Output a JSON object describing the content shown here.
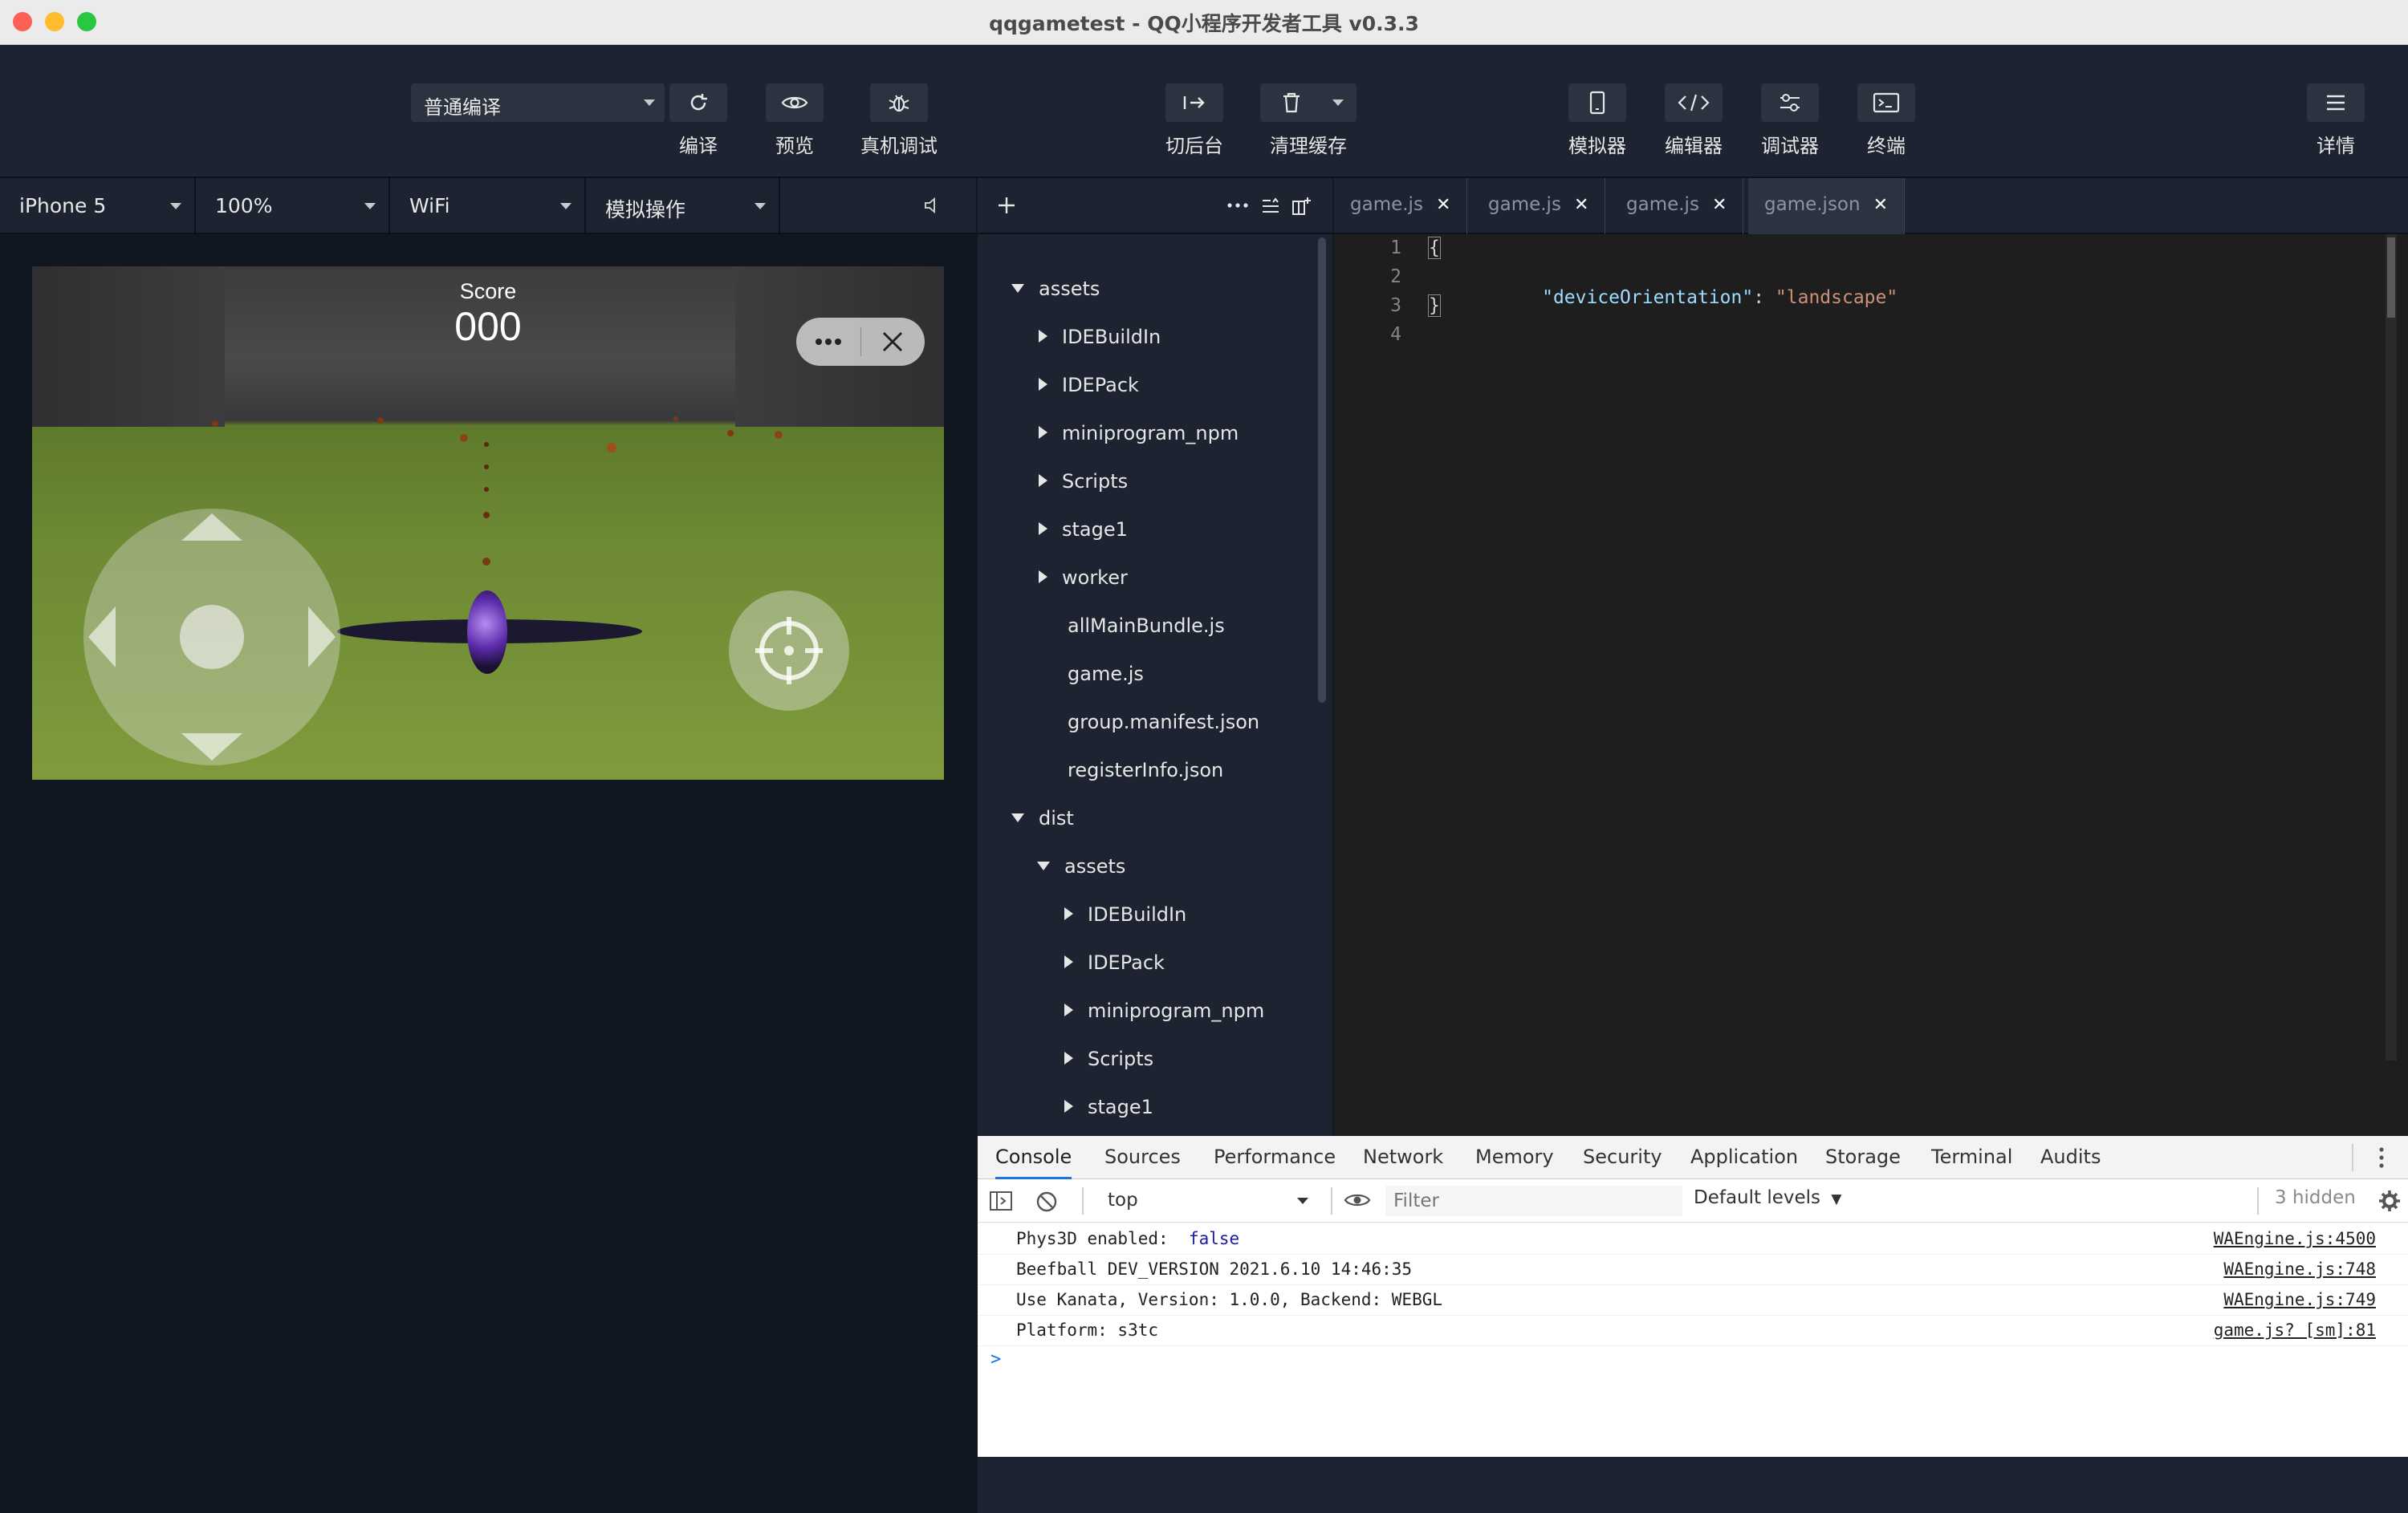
{
  "window": {
    "title": "qqgametest - QQ小程序开发者工具 v0.3.3"
  },
  "toolbar": {
    "compile_mode": "普通编译",
    "compile": "编译",
    "preview": "预览",
    "remote_debug": "真机调试",
    "background": "切后台",
    "clear_cache": "清理缓存",
    "simulator": "模拟器",
    "editor": "编辑器",
    "debugger": "调试器",
    "terminal": "终端",
    "details": "详情"
  },
  "devicebar": {
    "device": "iPhone 5",
    "zoom": "100%",
    "network": "WiFi",
    "operation": "模拟操作"
  },
  "game": {
    "score_label": "Score",
    "score_value": "000"
  },
  "filetree": {
    "items": [
      {
        "label": "assets",
        "type": "folder-open"
      },
      {
        "label": "IDEBuildIn",
        "type": "folder"
      },
      {
        "label": "IDEPack",
        "type": "folder"
      },
      {
        "label": "miniprogram_npm",
        "type": "folder"
      },
      {
        "label": "Scripts",
        "type": "folder"
      },
      {
        "label": "stage1",
        "type": "folder"
      },
      {
        "label": "worker",
        "type": "folder"
      },
      {
        "label": "allMainBundle.js",
        "type": "file"
      },
      {
        "label": "game.js",
        "type": "file"
      },
      {
        "label": "group.manifest.json",
        "type": "file"
      },
      {
        "label": "registerInfo.json",
        "type": "file"
      },
      {
        "label": "dist",
        "type": "folder-open"
      },
      {
        "label": "assets",
        "type": "folder-open"
      },
      {
        "label": "IDEBuildIn",
        "type": "folder"
      },
      {
        "label": "IDEPack",
        "type": "folder"
      },
      {
        "label": "miniprogram_npm",
        "type": "folder"
      },
      {
        "label": "Scripts",
        "type": "folder"
      },
      {
        "label": "stage1",
        "type": "folder"
      }
    ]
  },
  "editor": {
    "tabs": [
      "game.js",
      "game.js",
      "game.js",
      "game.json"
    ],
    "active_tab": "game.json",
    "line_numbers": [
      "1",
      "2",
      "3",
      "4"
    ],
    "line1": "{",
    "line2_key": "\"deviceOrientation\"",
    "line2_colon": ": ",
    "line2_value": "\"landscape\"",
    "line3": "}",
    "colors": {
      "key": "#9cdcfe",
      "string": "#ce9178",
      "brace": "#d4d4d4"
    }
  },
  "devtools": {
    "tabs": [
      "Console",
      "Sources",
      "Performance",
      "Network",
      "Memory",
      "Security",
      "Application",
      "Storage",
      "Terminal",
      "Audits"
    ],
    "context": "top",
    "filter_placeholder": "Filter",
    "levels": "Default levels",
    "hidden": "3 hidden",
    "logs": [
      {
        "message": "Phys3D enabled:  ",
        "value": "false",
        "source": "WAEngine.js:4500"
      },
      {
        "message": "Beefball DEV_VERSION 2021.6.10 14:46:35",
        "value": "",
        "source": "WAEngine.js:748"
      },
      {
        "message": "Use Kanata, Version: 1.0.0, Backend: WEBGL",
        "value": "",
        "source": "WAEngine.js:749"
      },
      {
        "message": "Platform: s3tc",
        "value": "",
        "source": "game.js? [sm]:81"
      }
    ],
    "prompt": ">"
  }
}
